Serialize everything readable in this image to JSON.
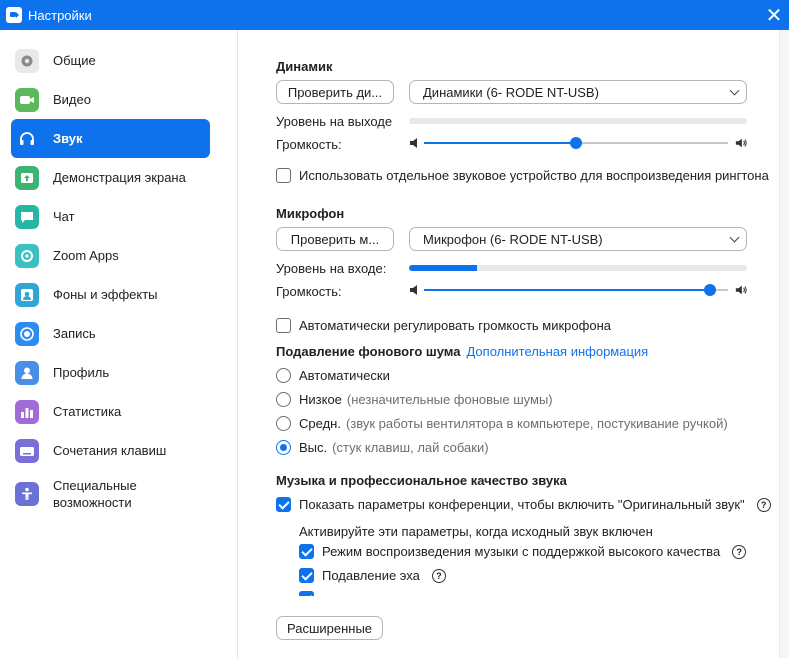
{
  "window": {
    "title": "Настройки",
    "close_glyph": "✕"
  },
  "sidebar": {
    "items": [
      {
        "label": "Общие",
        "icon": "gear-icon",
        "color": "#e9e9e9"
      },
      {
        "label": "Видео",
        "icon": "video-camera-icon",
        "color": "#5cb85c"
      },
      {
        "label": "Звук",
        "icon": "headphones-icon",
        "color": "#0e72ed",
        "active": true
      },
      {
        "label": "Демонстрация экрана",
        "icon": "share-screen-icon",
        "color": "#3cb371"
      },
      {
        "label": "Чат",
        "icon": "chat-bubble-icon",
        "color": "#26b6a6"
      },
      {
        "label": "Zoom Apps",
        "icon": "apps-icon",
        "color": "#3bc1c1"
      },
      {
        "label": "Фоны и эффекты",
        "icon": "background-effects-icon",
        "color": "#30a5d6"
      },
      {
        "label": "Запись",
        "icon": "record-icon",
        "color": "#2d8cf0"
      },
      {
        "label": "Профиль",
        "icon": "profile-icon",
        "color": "#4a8fe7"
      },
      {
        "label": "Статистика",
        "icon": "statistics-icon",
        "color": "#a16cd8"
      },
      {
        "label": "Сочетания клавиш",
        "icon": "keyboard-icon",
        "color": "#7a6fd6"
      },
      {
        "label": "Специальные\nвозможности",
        "icon": "accessibility-icon",
        "color": "#6b72d6"
      }
    ]
  },
  "speaker": {
    "heading": "Динамик",
    "test_button": "Проверить ди...",
    "device": "Динамики (6- RODE NT-USB)",
    "output_level_label": "Уровень на выходе",
    "output_level": 0,
    "volume_label": "Громкость:",
    "volume": 0.5,
    "separate_device_label": "Использовать отдельное звуковое устройство для воспроизведения рингтона",
    "separate_device_checked": false
  },
  "microphone": {
    "heading": "Микрофон",
    "test_button": "Проверить м...",
    "device": "Микрофон (6- RODE NT-USB)",
    "input_level_label": "Уровень на входе:",
    "input_level": 0.2,
    "volume_label": "Громкость:",
    "volume": 0.94,
    "auto_adjust_label": "Автоматически регулировать громкость микрофона",
    "auto_adjust_checked": false
  },
  "noise": {
    "heading": "Подавление фонового шума",
    "link": "Дополнительная информация",
    "options": [
      {
        "label": "Автоматически",
        "hint": "",
        "selected": false
      },
      {
        "label": "Низкое",
        "hint": "(незначительные фоновые шумы)",
        "selected": false
      },
      {
        "label": "Средн.",
        "hint": "(звук работы вентилятора в компьютере, постукивание ручкой)",
        "selected": false
      },
      {
        "label": "Выс.",
        "hint": "(стук клавиш, лай собаки)",
        "selected": true
      }
    ]
  },
  "music": {
    "heading": "Музыка и профессиональное качество звука",
    "show_options_label": "Показать параметры конференции, чтобы включить \"Оригинальный звук\"",
    "show_options_checked": true,
    "activate_note": "Активируйте эти параметры, когда исходный звук включен",
    "hifi_label": "Режим воспроизведения музыки с поддержкой высокого качества",
    "hifi_checked": true,
    "echo_label": "Подавление эха",
    "echo_checked": true,
    "help_glyph": "?"
  },
  "advanced_button": "Расширенные",
  "colors": {
    "accent": "#0e72ed",
    "titlebar": "#0e72ed"
  }
}
